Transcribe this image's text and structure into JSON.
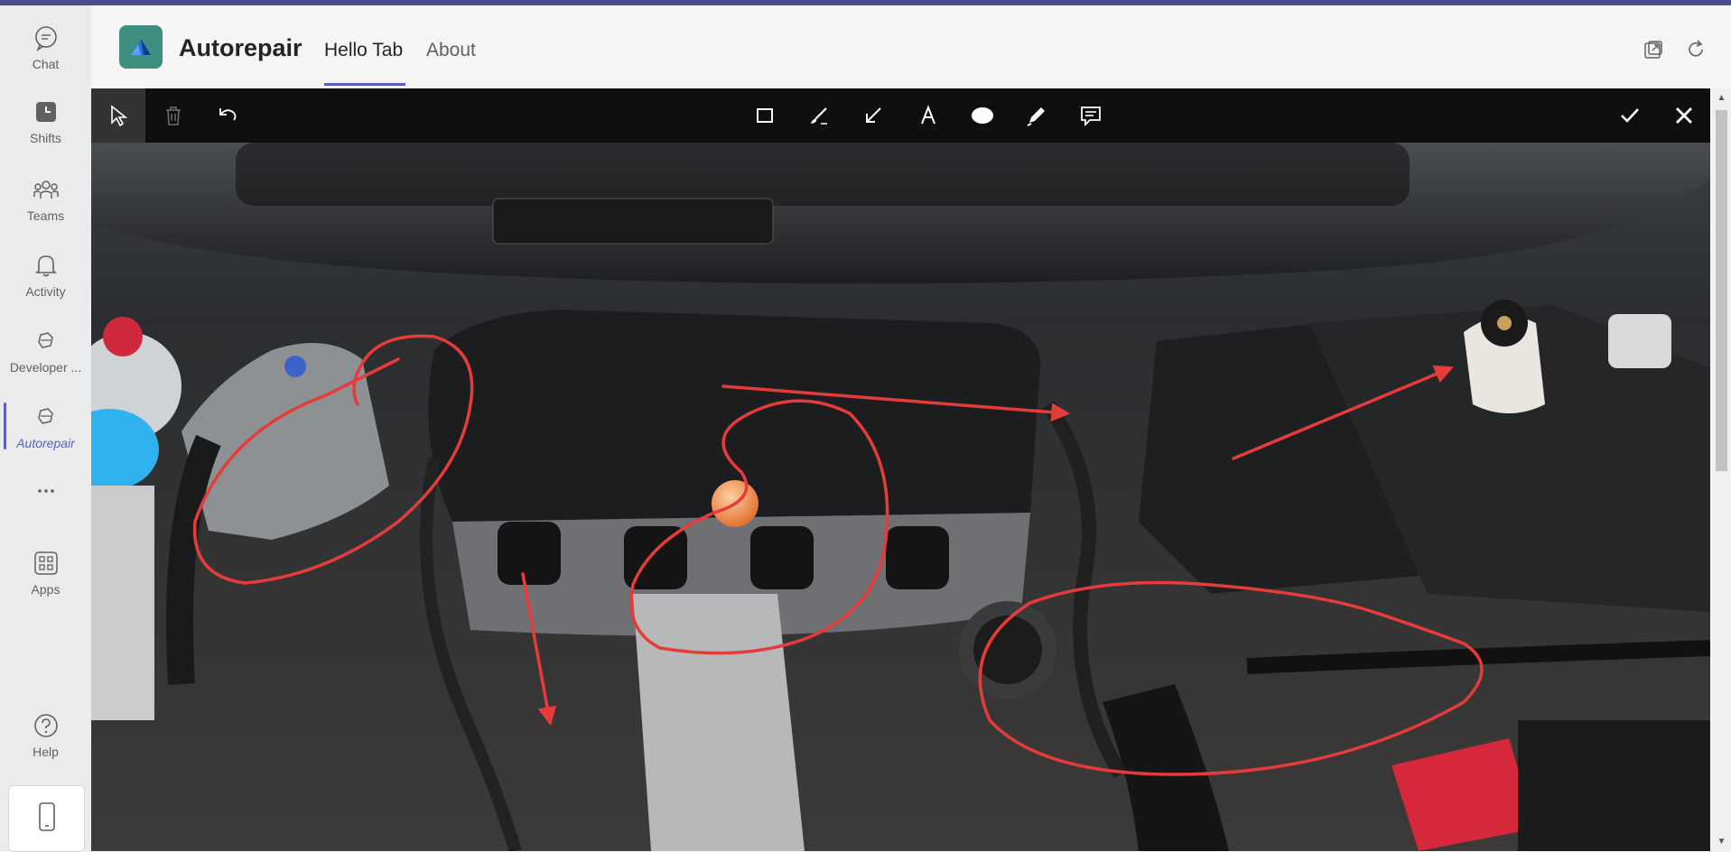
{
  "app": {
    "name": "Autorepair",
    "tabs": [
      {
        "label": "Hello Tab",
        "active": true
      },
      {
        "label": "About",
        "active": false
      }
    ],
    "accent": "#5b5fc7"
  },
  "rail": {
    "items": [
      {
        "label": "Chat",
        "icon": "chat-icon"
      },
      {
        "label": "Shifts",
        "icon": "shifts-icon"
      },
      {
        "label": "Teams",
        "icon": "teams-icon"
      },
      {
        "label": "Activity",
        "icon": "bell-icon"
      },
      {
        "label": "Developer ...",
        "icon": "developer-portal-icon"
      },
      {
        "label": "Autorepair",
        "icon": "autorepair-app-icon",
        "active": true
      },
      {
        "label": "",
        "icon": "more-dots-icon"
      },
      {
        "label": "Apps",
        "icon": "apps-grid-icon"
      },
      {
        "label": "Help",
        "icon": "help-icon"
      }
    ]
  },
  "toolbar": {
    "left": [
      "select-pointer-icon",
      "delete-trash-icon",
      "undo-icon"
    ],
    "center": [
      "rectangle-icon",
      "brush-icon",
      "arrow-icon",
      "text-icon",
      "ellipse-icon",
      "pen-icon",
      "comment-icon"
    ],
    "right": [
      "confirm-check-icon",
      "close-icon"
    ]
  },
  "annotation_color": "#e63b3b"
}
